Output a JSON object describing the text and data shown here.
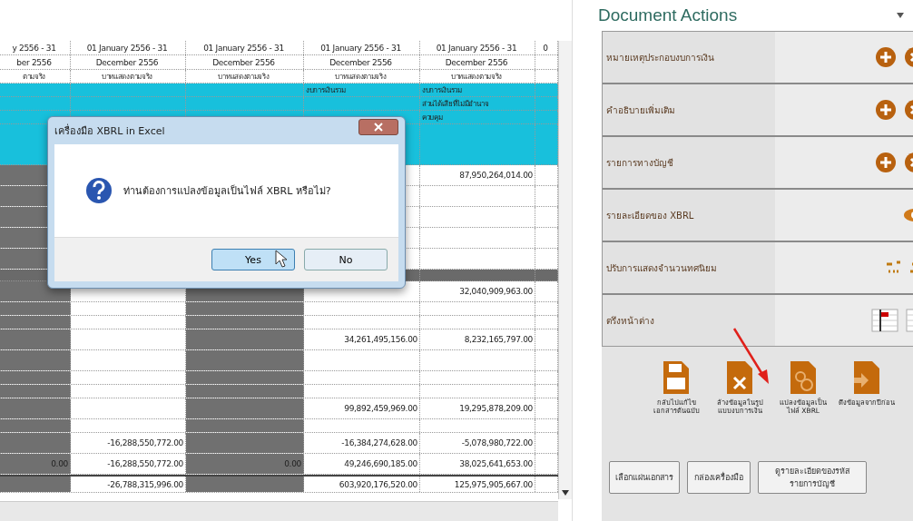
{
  "sheet": {
    "columns": [
      {
        "shaded": true
      },
      {
        "shaded": false
      },
      {
        "shaded": true
      },
      {
        "shaded": false
      },
      {
        "shaded": false
      },
      {
        "shaded": false
      }
    ],
    "rows": [
      {
        "kind": "header",
        "column_1": "y 2556 - 31",
        "column_2": "01 January 2556 - 31",
        "column_3": "01 January 2556 - 31",
        "column_4": "01 January 2556 - 31",
        "column_5": "01 January 2556 - 31",
        "column_6": "0"
      },
      {
        "kind": "header",
        "column_1": "ber 2556",
        "column_2": "December 2556",
        "column_3": "December 2556",
        "column_4": "December 2556",
        "column_5": "December 2556"
      },
      {
        "kind": "unit",
        "column_1": "ตามจริง",
        "column_2": "บาทแสดงตามจริง",
        "column_3": "บาทแสดงตามจริง",
        "column_4": "บาทแสดงตามจริง",
        "column_5": "บาทแสดงตามจริง"
      },
      {
        "kind": "cyan",
        "column_4": "งบการเงินรวม",
        "column_5": "งบการเงินรวม"
      },
      {
        "kind": "cyan",
        "column_5": "ส่วนได้เสียที่ไม่มีอำนาจ"
      },
      {
        "kind": "cyan",
        "column_5": "ควบคุม"
      },
      {
        "kind": "cyan-space"
      },
      {
        "kind": "data",
        "column_5": "87,950,264,014.00"
      },
      {
        "kind": "data"
      },
      {
        "kind": "data"
      },
      {
        "kind": "data"
      },
      {
        "kind": "data"
      },
      {
        "kind": "band"
      },
      {
        "kind": "data",
        "column_5": "32,040,909,963.00"
      },
      {
        "kind": "spacer"
      },
      {
        "kind": "spacer"
      },
      {
        "kind": "data",
        "column_4": "34,261,495,156.00",
        "column_5": "8,232,165,797.00"
      },
      {
        "kind": "data"
      },
      {
        "kind": "spacer"
      },
      {
        "kind": "spacer"
      },
      {
        "kind": "data",
        "column_4": "99,892,459,969.00",
        "column_5": "19,295,878,209.00"
      },
      {
        "kind": "spacer"
      },
      {
        "kind": "data",
        "column_2": "-16,288,550,772.00",
        "column_4": "-16,384,274,628.00",
        "column_5": "-5,078,980,722.00"
      },
      {
        "kind": "data",
        "column_1": "0.00",
        "column_2": "-16,288,550,772.00",
        "column_3": "0.00",
        "column_4": "49,246,690,185.00",
        "column_5": "38,025,641,653.00"
      },
      {
        "kind": "total",
        "column_2": "-26,788,315,996.00",
        "column_4": "603,920,176,520.00",
        "column_5": "125,975,905,667.00"
      }
    ]
  },
  "dialog": {
    "title": "เครื่องมือ XBRL in Excel",
    "message": "ท่านต้องการแปลงข้อมูลเป็นไฟล์ XBRL หรือไม่?",
    "buttons": [
      {
        "label": "Yes",
        "selected": true
      },
      {
        "label": "No",
        "selected": false
      }
    ]
  },
  "panel": {
    "title": "Document Actions",
    "items": [
      {
        "label": "หมายเหตุประกอบงบการเงิน",
        "kind": "add-remove"
      },
      {
        "label": "คำอธิบายเพิ่มเติม",
        "kind": "add-remove"
      },
      {
        "label": "รายการทางบัญชี",
        "kind": "add-remove"
      },
      {
        "label": "รายละเอียดของ XBRL",
        "kind": "view"
      },
      {
        "label": "ปรับการแสดงจำนวนทศนิยม",
        "kind": "decimal"
      },
      {
        "label": "ตรึงหน้าต่าง",
        "kind": "freeze"
      }
    ],
    "actions": [
      {
        "label": "กลับไปแก้ไขเอกสารต้นฉบับ",
        "kind": "save"
      },
      {
        "label": "ล้างข้อมูลในรูปแบบงบการเงิน",
        "kind": "clear"
      },
      {
        "label": "แปลงข้อมูลเป็นไฟล์ XBRL",
        "kind": "convert"
      },
      {
        "label": "ดึงข้อมูลจากปีก่อน",
        "kind": "import"
      }
    ],
    "buttons": [
      "เลือกแผ่นเอกสาร",
      "กล่องเครื่องมือ",
      "ดูรายละเอียดของรหัสรายการบัญชี"
    ]
  }
}
